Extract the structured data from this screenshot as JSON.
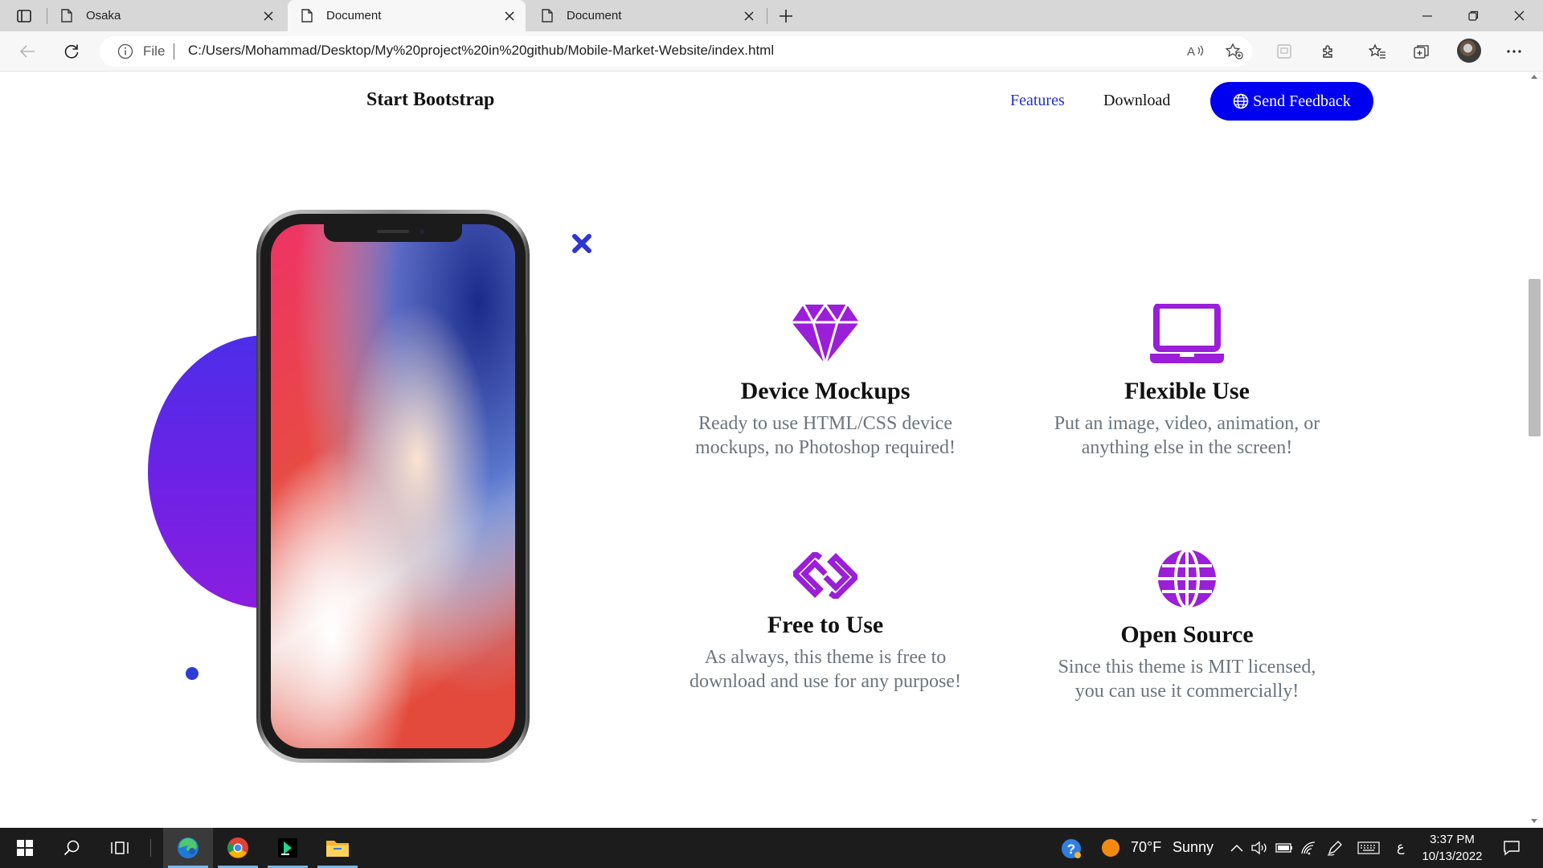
{
  "browser": {
    "tabs": [
      {
        "title": "Osaka",
        "active": false
      },
      {
        "title": "Document",
        "active": true
      },
      {
        "title": "Document",
        "active": false
      }
    ],
    "address_bar": {
      "scheme_label": "File",
      "url": "C:/Users/Mohammad/Desktop/My%20project%20in%20github/Mobile-Market-Website/index.html"
    }
  },
  "navbar": {
    "brand": "Start Bootstrap",
    "links": [
      {
        "label": "Features",
        "active": true
      },
      {
        "label": "Download",
        "active": false
      }
    ],
    "cta_label": "Send Feedback"
  },
  "features": [
    {
      "icon": "gem-icon",
      "title": "Device Mockups",
      "line1": "Ready to use HTML/CSS device",
      "line2": "mockups, no Photoshop required!"
    },
    {
      "icon": "laptop-icon",
      "title": "Flexible Use",
      "line1": "Put an image, video, animation, or",
      "line2": "anything else in the screen!"
    },
    {
      "icon": "link-chain-icon",
      "title": "Free to Use",
      "line1": "As always, this theme is free to",
      "line2": "download and use for any purpose!"
    },
    {
      "icon": "globe-icon",
      "title": "Open Source",
      "line1": "Since this theme is MIT licensed,",
      "line2": "you can use it commercially!"
    }
  ],
  "colors": {
    "accent_purple": "#9b1ed8",
    "primary_blue": "#0000f0",
    "nav_active": "#2332c9",
    "muted_text": "#6c757d"
  },
  "taskbar": {
    "weather_temp": "70°F",
    "weather_text": "Sunny",
    "keyboard_lang": "ع",
    "time": "3:37 PM",
    "date": "10/13/2022"
  }
}
